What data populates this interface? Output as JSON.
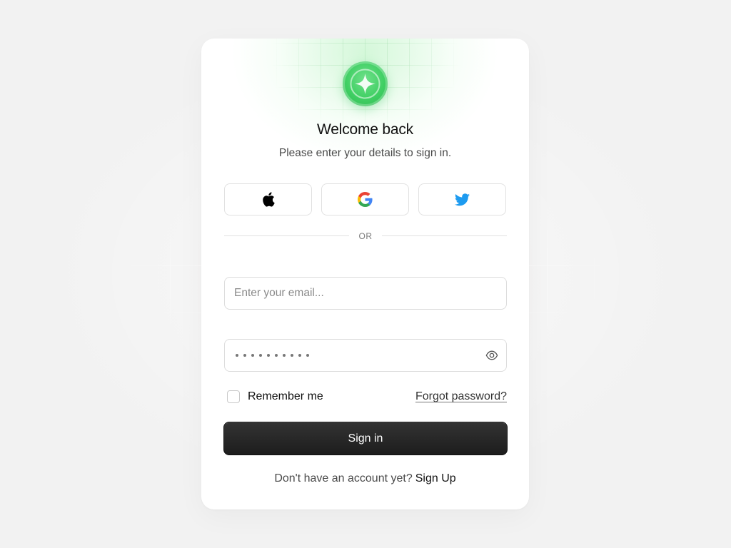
{
  "header": {
    "title": "Welcome back",
    "subtitle": "Please enter your details to sign in."
  },
  "logo": {
    "icon": "sparkle-star-icon",
    "color": "#3fcf63"
  },
  "social_buttons": [
    {
      "provider": "Apple",
      "icon": "apple-icon"
    },
    {
      "provider": "Google",
      "icon": "google-icon"
    },
    {
      "provider": "Twitter",
      "icon": "twitter-icon",
      "color": "#1d9bf0"
    }
  ],
  "divider": {
    "text": "OR"
  },
  "form": {
    "email_placeholder": "Enter your email...",
    "password_mask": "••••••••••",
    "password_toggle_icon": "eye-icon",
    "remember_label": "Remember me",
    "remember_checked": false,
    "forgot_label": "Forgot password?",
    "submit_label": "Sign in"
  },
  "footer": {
    "prompt": "Don't have an account yet?",
    "signup_label": "Sign Up"
  }
}
